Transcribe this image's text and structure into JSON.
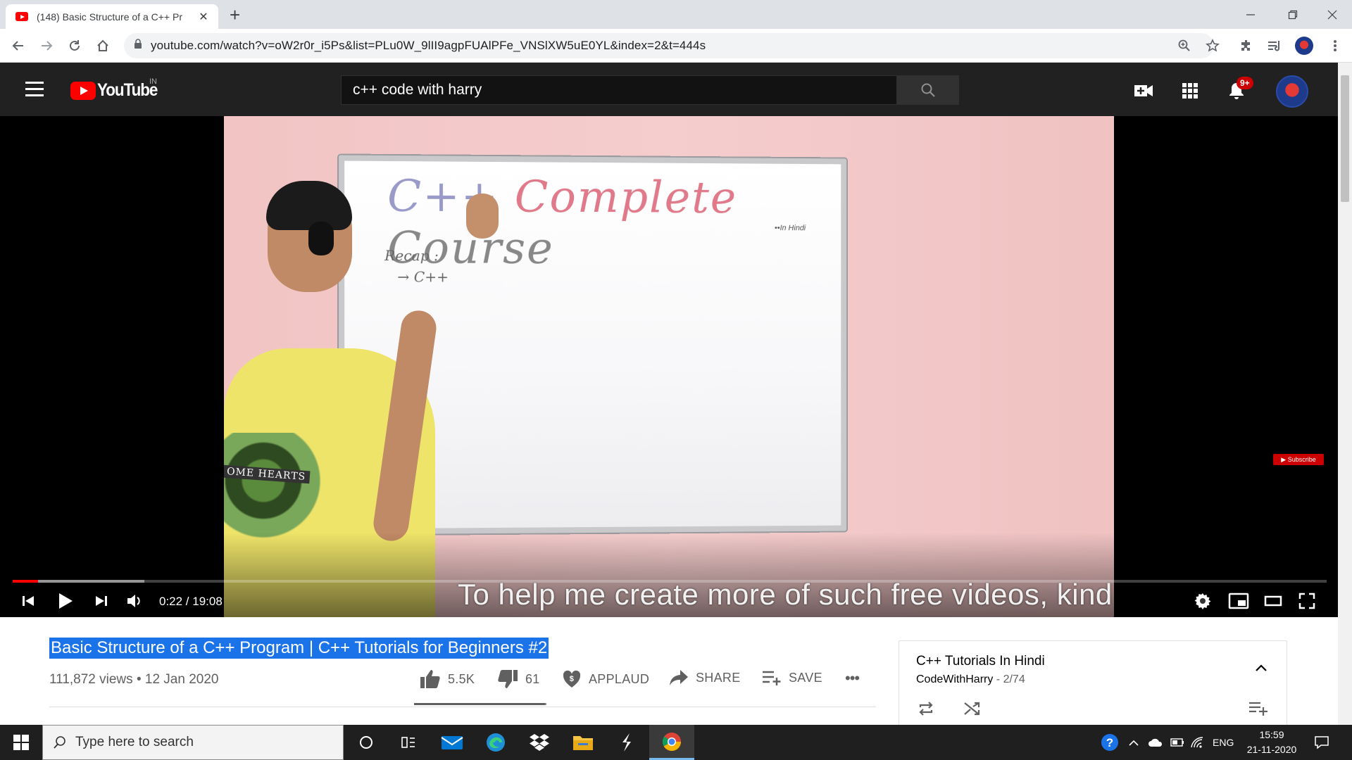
{
  "browser": {
    "tab_title": "(148) Basic Structure of a C++ Pr",
    "tab_close": "✕",
    "new_tab": "+",
    "url": "youtube.com/watch?v=oW2r0r_i5Ps&list=PLu0W_9lII9agpFUAlPFe_VNSlXW5uE0YL&index=2&t=444s",
    "icons": [
      "back-icon",
      "forward-icon",
      "reload-icon",
      "home-icon",
      "lock-icon",
      "zoom-icon",
      "star-icon",
      "extensions-icon",
      "media-icon",
      "profile-icon",
      "menu-icon",
      "minimize-icon",
      "maximize-icon",
      "close-icon"
    ]
  },
  "masthead": {
    "logo_text": "YouTube",
    "country": "IN",
    "search_value": "c++ code with harry",
    "notification_count": "9+",
    "brand_color": "#ff0000",
    "icons": [
      "menu-icon",
      "search-icon",
      "create-video-icon",
      "apps-icon",
      "notifications-icon",
      "avatar"
    ]
  },
  "player": {
    "board_title_cpp": "C++",
    "board_title_main": " Complete ",
    "board_title_course": "Course",
    "board_subtitle": "••In Hindi",
    "board_recap_line1": "Recap :",
    "board_recap_line2": "→ C++",
    "shirt_text": "OME HEARTS",
    "subscribe_watermark": "▶ Subscribe",
    "time_current": "0:22",
    "time_total": "19:08",
    "time_display": "0:22 / 19:08",
    "progress_played_fraction": 0.0192,
    "progress_loaded_fraction": 0.1,
    "caption": "To help me create more of such free videos, kind",
    "icons": [
      "previous-icon",
      "play-icon",
      "next-icon",
      "volume-icon",
      "settings-icon",
      "miniplayer-icon",
      "theater-icon",
      "fullscreen-icon"
    ]
  },
  "video": {
    "title": "Basic Structure of a C++ Program | C++ Tutorials for Beginners #2",
    "views": "111,872 views",
    "separator": "•",
    "date": "12 Jan 2020",
    "likes": "5.5K",
    "dislikes": "61",
    "applaud": "APPLAUD",
    "share": "SHARE",
    "save": "SAVE",
    "more": "•••",
    "like_fraction": 0.989
  },
  "playlist": {
    "title": "C++ Tutorials In Hindi",
    "owner": "CodeWithHarry",
    "position": " - 2/74",
    "icons": [
      "collapse-icon",
      "loop-icon",
      "shuffle-icon",
      "add-to-queue-icon"
    ]
  },
  "taskbar": {
    "search_placeholder": "Type here to search",
    "language": "ENG",
    "time": "15:59",
    "date": "21-11-2020",
    "apps": [
      "cortana-icon",
      "task-view-icon",
      "mail-icon",
      "edge-icon",
      "dropbox-icon",
      "file-explorer-icon",
      "sublime-icon",
      "chrome-icon"
    ],
    "tray_icons": [
      "help-icon",
      "chevron-up-icon",
      "onedrive-icon",
      "battery-icon",
      "wifi-icon",
      "notification-center-icon"
    ]
  }
}
